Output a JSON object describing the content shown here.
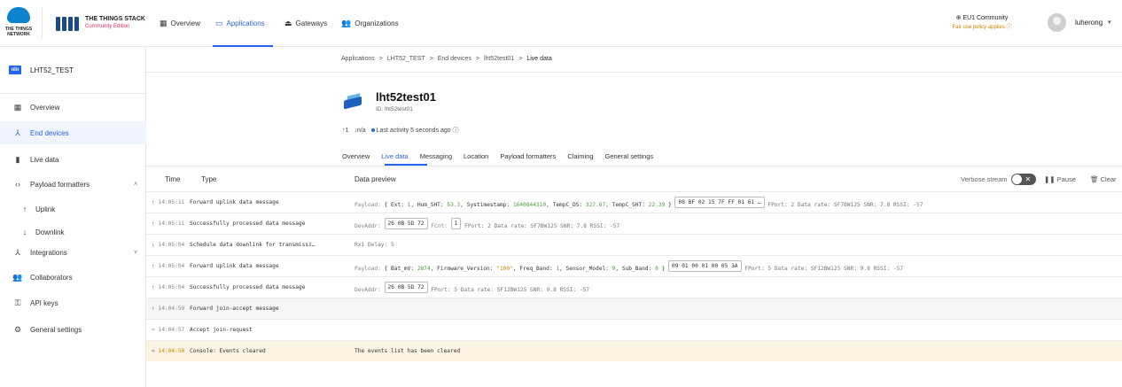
{
  "brand": {
    "ttn_text": "THE THINGS NETWORK",
    "tts_title": "THE THINGS STACK",
    "tts_subtitle": "Community Edition"
  },
  "nav": {
    "overview": "Overview",
    "applications": "Applications",
    "gateways": "Gateways",
    "organizations": "Organizations"
  },
  "cluster": {
    "name": "EU1 Community",
    "fair_use": "Fair use policy applies ⓘ"
  },
  "user": {
    "name": "luherong"
  },
  "sidebar": {
    "app_badge": "ıılıı",
    "app_name": "LHT52_TEST",
    "items": [
      {
        "label": "Overview",
        "icon": "grid-icon"
      },
      {
        "label": "End devices",
        "icon": "end-devices-icon"
      },
      {
        "label": "Live data",
        "icon": "chart-icon"
      },
      {
        "label": "Payload formatters",
        "icon": "code-icon"
      },
      {
        "label": "Uplink",
        "icon": "arrow-up-icon"
      },
      {
        "label": "Downlink",
        "icon": "arrow-down-icon"
      },
      {
        "label": "Integrations",
        "icon": "integrations-icon"
      },
      {
        "label": "Collaborators",
        "icon": "people-icon"
      },
      {
        "label": "API keys",
        "icon": "key-icon"
      },
      {
        "label": "General settings",
        "icon": "gear-icon"
      }
    ]
  },
  "breadcrumb": {
    "items": [
      "Applications",
      "LHT52_TEST",
      "End devices",
      "lht52test01",
      "Live data"
    ],
    "separator": ">"
  },
  "device": {
    "title": "lht52test01",
    "id": "ID: lht52test01",
    "uplinks": "1",
    "downlinks": "n/a",
    "last_activity": "Last activity 5 seconds ago ⓘ"
  },
  "tabs": [
    "Overview",
    "Live data",
    "Messaging",
    "Location",
    "Payload formatters",
    "Claiming",
    "General settings"
  ],
  "table": {
    "headers": {
      "time": "Time",
      "type": "Type",
      "preview": "Data preview"
    },
    "verbose_label": "Verbose stream",
    "pause_label": "Pause",
    "clear_label": "Clear"
  },
  "rows": [
    {
      "arrow": "↑",
      "time": "14:05:11",
      "type": "Forward uplink data message",
      "payload_prefix": "Payload: { Ext: ",
      "payload_parts": [
        {
          "k": "Ext",
          "v": "1"
        },
        {
          "k": "Hum_SHT",
          "v": "53.3"
        },
        {
          "k": "Systimestamp",
          "v": "1640844310"
        },
        {
          "k": "TempC_DS",
          "v": "327.67"
        },
        {
          "k": "TempC_SHT",
          "v": "22.39"
        }
      ],
      "hex": "08 BF 02 15 7F FF 01 61 …",
      "tail": "FPort: 2  Data rate: SF7BW125  SNR: 7.8  RSSI: -57"
    },
    {
      "arrow": "↑",
      "time": "14:05:11",
      "type": "Successfully processed data message",
      "devaddr_label": "DevAddr:",
      "devaddr": "26 0B 5D 72",
      "fcnt_label": "FCnt:",
      "fcnt": "1",
      "tail": "FPort: 2  Data rate: SF7BW125  SNR: 7.8  RSSI: -57"
    },
    {
      "arrow": "↓",
      "time": "14:05:04",
      "type": "Schedule data downlink for transmissi…",
      "preview": "Rx1 Delay: 5"
    },
    {
      "arrow": "↑",
      "time": "14:05:04",
      "type": "Forward uplink data message",
      "payload_parts": [
        {
          "k": "Bat_mV",
          "v": "2874"
        },
        {
          "k": "Firmware_Version",
          "v": "\"100\""
        },
        {
          "k": "Freq_Band",
          "v": "1"
        },
        {
          "k": "Sensor_Model",
          "v": "9"
        },
        {
          "k": "Sub_Band",
          "v": "0"
        }
      ],
      "hex": "09 01 00 01 00 05 3A",
      "tail": "FPort: 5  Data rate: SF12BW125  SNR: 9.8  RSSI: -57"
    },
    {
      "arrow": "↑",
      "time": "14:05:04",
      "type": "Successfully processed data message",
      "devaddr_label": "DevAddr:",
      "devaddr": "26 0B 5D 72",
      "tail": "FPort: 5  Data rate: SF12BW125  SNR: 9.8  RSSI: -57"
    },
    {
      "arrow": "↑",
      "time": "14:04:59",
      "type": "Forward join-accept message"
    },
    {
      "arrow": "⇔",
      "time": "14:04:57",
      "type": "Accept join-request"
    },
    {
      "arrow": "⇆",
      "time": "14:04:50",
      "type": "Console: Events cleared",
      "preview": "The events list has been cleared"
    }
  ],
  "colors": {
    "accent": "#2563eb",
    "warn_bg": "#fdf3e2",
    "value_green": "#4a9e3a",
    "string_amber": "#c58a00"
  }
}
